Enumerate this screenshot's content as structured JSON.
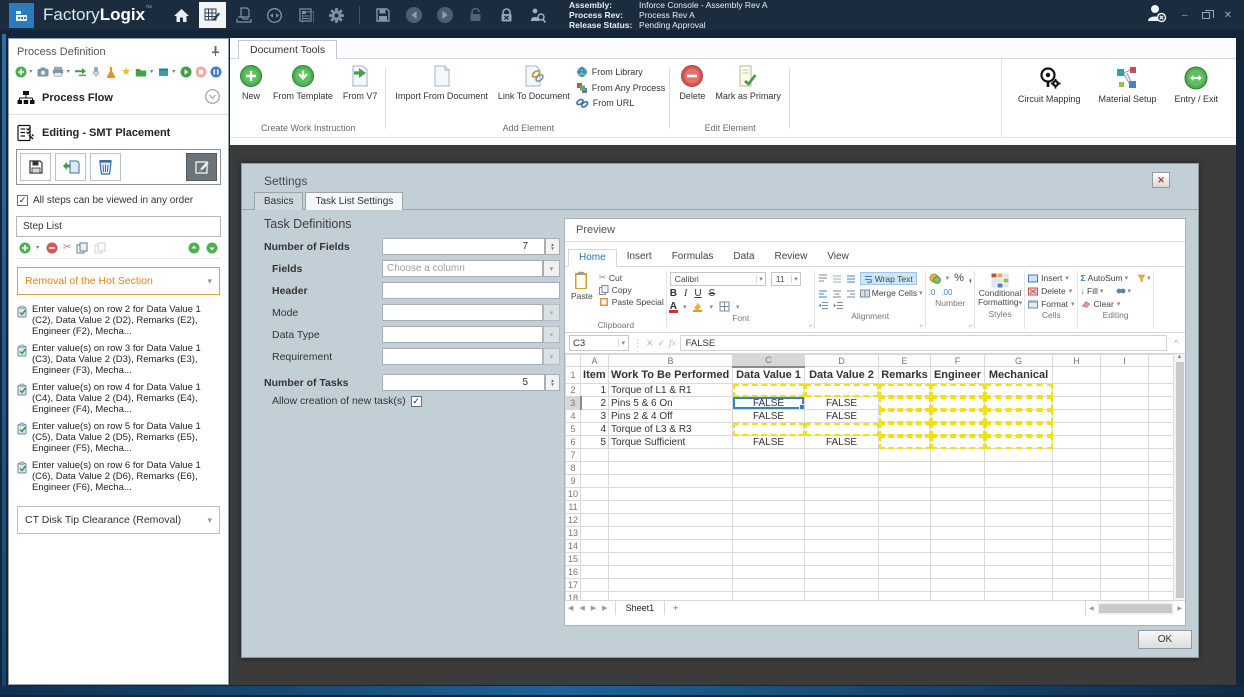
{
  "icons": {
    "dropdown": "▾",
    "check": "✓",
    "scissors": "✂",
    "sigma": "Σ",
    "percent": "%",
    "comma": ",",
    "star": "★",
    "left_arrow": "◀",
    "right_arrow": "▶",
    "up_arrow": "▲",
    "down_arrow": "▼",
    "caret": "^",
    "close": "✕",
    "minimize": "–",
    "plus": "+",
    "minus": "−",
    "bold": "B",
    "italic": "I",
    "underline": "U",
    "strike": "S",
    "font_color": "A",
    "fx": "fx",
    "fill_arrow": "↓",
    "dec0": ".0",
    "dec00": ".00",
    "dots": "⋮",
    "chevron_down": "▾"
  },
  "titlebar": {
    "app_name_light": "Factory",
    "app_name_bold": "Logix",
    "trademark": "™",
    "assembly_label": "Assembly:",
    "assembly_value": "Inforce Console - Assembly Rev A",
    "process_rev_label": "Process Rev:",
    "process_rev_value": "Process Rev A",
    "release_status_label": "Release Status:",
    "release_status_value": "Pending Approval"
  },
  "left_panel": {
    "title": "Process Definition",
    "process_flow_label": "Process Flow",
    "editing_label": "Editing - SMT Placement",
    "order_checkbox_label": "All steps can be viewed in any order",
    "step_list_title": "Step List",
    "selected_group_label": "Removal of the Hot Section",
    "steps": [
      "Enter value(s) on row 2 for Data Value 1 (C2), Data Value 2 (D2), Remarks (E2), Engineer (F2), Mecha...",
      "Enter value(s) on row 3 for Data Value 1 (C3), Data Value 2 (D3), Remarks (E3), Engineer (F3), Mecha...",
      "Enter value(s) on row 4 for Data Value 1 (C4), Data Value 2 (D4), Remarks (E4), Engineer (F4), Mecha...",
      "Enter value(s) on row 5 for Data Value 1 (C5), Data Value 2 (D5), Remarks (E5), Engineer (F5), Mecha...",
      "Enter value(s) on row 6 for Data Value 1 (C6), Data Value 2 (D6), Remarks (E6), Engineer (F6), Mecha..."
    ],
    "bottom_group_label": "CT Disk Tip Clearance (Removal)"
  },
  "doc_ribbon": {
    "tab_label": "Document Tools",
    "new_label": "New",
    "from_template_label": "From Template",
    "from_v7_label": "From V7",
    "group1_label": "Create Work Instruction",
    "import_label": "Import From Document",
    "link_label": "Link To Document",
    "from_library_label": "From Library",
    "from_any_process_label": "From Any Process",
    "from_url_label": "From URL",
    "group2_label": "Add Element",
    "delete_label": "Delete",
    "mark_primary_label": "Mark as Primary",
    "group3_label": "Edit Element",
    "circuit_mapping_label": "Circuit Mapping",
    "material_setup_label": "Material Setup",
    "entry_exit_label": "Entry / Exit"
  },
  "dialog": {
    "title": "Settings",
    "tab_basics": "Basics",
    "tab_task_list": "Task List Settings",
    "section_title": "Task Definitions",
    "number_of_fields_label": "Number of Fields",
    "number_of_fields_value": "7",
    "fields_label": "Fields",
    "fields_placeholder": "Choose a column",
    "header_label": "Header",
    "mode_label": "Mode",
    "data_type_label": "Data Type",
    "requirement_label": "Requirement",
    "number_of_tasks_label": "Number of Tasks",
    "number_of_tasks_value": "5",
    "allow_new_tasks_label": "Allow creation of new task(s)",
    "ok_label": "OK"
  },
  "preview": {
    "title": "Preview",
    "tabs": [
      "Home",
      "Insert",
      "Formulas",
      "Data",
      "Review",
      "View"
    ],
    "active_tab": "Home",
    "paste_label": "Paste",
    "cut_label": "Cut",
    "copy_label": "Copy",
    "paste_special_label": "Paste Special",
    "clipboard_group_label": "Clipboard",
    "font_name": "Calibri",
    "font_size": "11",
    "font_group_label": "Font",
    "wrap_text_label": "Wrap Text",
    "merge_cells_label": "Merge Cells",
    "alignment_group_label": "Alignment",
    "number_group_label": "Number",
    "conditional_formatting_label_1": "Conditional",
    "conditional_formatting_label_2": "Formatting",
    "styles_group_label": "Styles",
    "insert_label": "Insert",
    "delete_label": "Delete",
    "format_label": "Format",
    "cells_group_label": "Cells",
    "autosum_label": "AutoSum",
    "fill_label": "Fill",
    "clear_label": "Clear",
    "editing_group_label": "Editing",
    "name_box_value": "C3",
    "formula_bar_value": "FALSE",
    "sheet_tab_label": "Sheet1",
    "add_sheet_label": "+"
  },
  "grid": {
    "column_letters": [
      "A",
      "B",
      "C",
      "D",
      "E",
      "F",
      "G",
      "H",
      "I"
    ],
    "selected_column": "C",
    "selected_row": 3,
    "selected_cell": "C3",
    "header_row": [
      "Item",
      "Work To Be Performed",
      "Data Value 1",
      "Data Value 2",
      "Remarks",
      "Engineer",
      "Mechanical",
      "",
      ""
    ],
    "data_rows": [
      {
        "row": 2,
        "cells": {
          "A": "1",
          "B": "Torque of L1 & R1",
          "C": "",
          "D": "",
          "E": "",
          "F": "",
          "G": ""
        }
      },
      {
        "row": 3,
        "cells": {
          "A": "2",
          "B": "Pins 5 & 6 On",
          "C": "FALSE",
          "D": "FALSE",
          "E": "",
          "F": "",
          "G": ""
        }
      },
      {
        "row": 4,
        "cells": {
          "A": "3",
          "B": "Pins 2 & 4 Off",
          "C": "FALSE",
          "D": "FALSE",
          "E": "",
          "F": "",
          "G": ""
        }
      },
      {
        "row": 5,
        "cells": {
          "A": "4",
          "B": "Torque of L3 & R3",
          "C": "",
          "D": "",
          "E": "",
          "F": "",
          "G": ""
        }
      },
      {
        "row": 6,
        "cells": {
          "A": "5",
          "B": "Torque Sufficient",
          "C": "FALSE",
          "D": "FALSE",
          "E": "",
          "F": "",
          "G": ""
        }
      }
    ],
    "empty_row_numbers": [
      7,
      8,
      9,
      10,
      11,
      12,
      13,
      14,
      15,
      16,
      17,
      18
    ],
    "dashed_cells": [
      "C2",
      "D2",
      "E2",
      "F2",
      "G2",
      "E3",
      "F3",
      "G3",
      "E4",
      "F4",
      "G4",
      "C5",
      "D5",
      "E5",
      "F5",
      "G5",
      "E6",
      "F6",
      "G6"
    ]
  },
  "colors": {
    "titlebar_bg": "#1b2c3f",
    "logo_blue": "#2b7bbf",
    "accent_orange": "#e8820a",
    "dialog_bg": "#c3cfd7",
    "doc_area_bg": "#3b3b3b",
    "selection_blue": "#2f86c0",
    "dashed_yellow": "#efe20e",
    "excel_tab_blue": "#2b6cb5"
  }
}
